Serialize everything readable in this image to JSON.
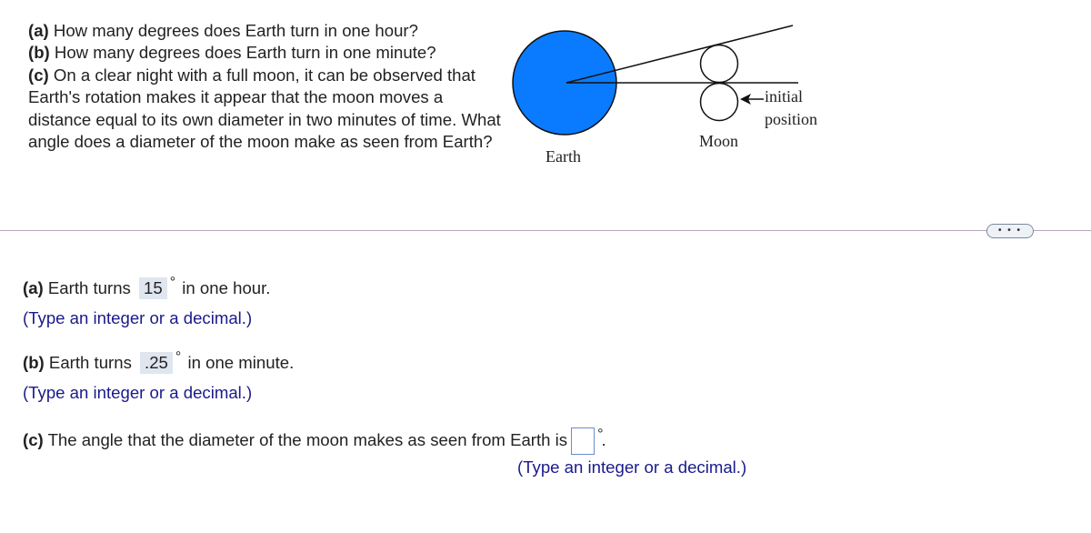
{
  "question": {
    "a_label": "(a)",
    "a_text": " How many degrees does Earth turn in one hour?",
    "b_label": "(b)",
    "b_text": " How many degrees does Earth turn in one minute?",
    "c_label": "(c)",
    "c_text": " On a clear night with a full moon, it can be observed that Earth's rotation makes it appear that the moon moves a distance equal to its own diameter in two minutes of time. What angle does a diameter of the moon make as seen from Earth?"
  },
  "figure": {
    "earth_label": "Earth",
    "moon_label": "Moon",
    "initial_label_line1": "initial",
    "initial_label_line2": "position",
    "earth_color": "#0a7bff"
  },
  "more_button": "• • •",
  "answers": {
    "a": {
      "label": "(a)",
      "prefix": " Earth turns",
      "value": "15",
      "degree": "°",
      "suffix": " in one hour.",
      "hint": "(Type an integer or a decimal.)"
    },
    "b": {
      "label": "(b)",
      "prefix": " Earth turns",
      "value": ".25",
      "degree": "°",
      "suffix": " in one minute.",
      "hint": "(Type an integer or a decimal.)"
    },
    "c": {
      "label": "(c)",
      "prefix": " The angle that the diameter of the moon makes as seen from Earth is",
      "value": "",
      "degree": "°",
      "suffix": ".",
      "hint": "(Type an integer or a decimal.)"
    }
  }
}
